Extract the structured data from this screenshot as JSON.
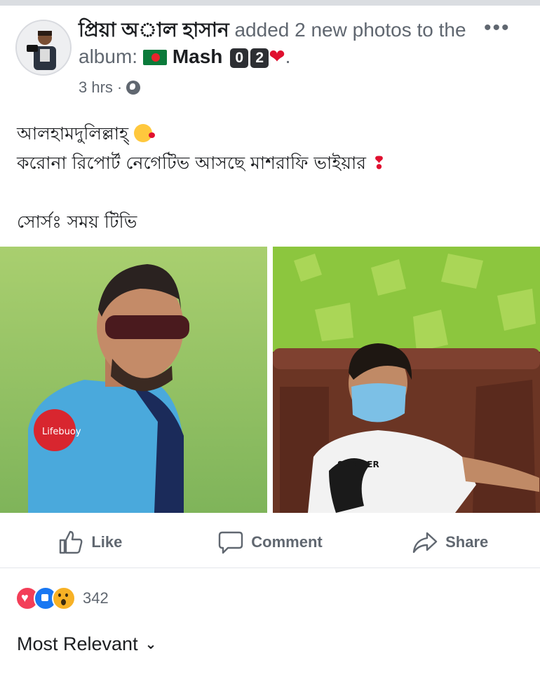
{
  "post": {
    "author": "প্রিয়া অাল হাসান",
    "action_text": "added 2 new photos to the album:",
    "album_name": "Mash",
    "album_digits": [
      "0",
      "2"
    ],
    "timestamp": "3 hrs",
    "privacy_icon": "globe-icon",
    "menu_icon": "more-icon",
    "text_lines": [
      "আলহামদুলিল্লাহ্",
      "করোনা রিপোর্ট নেগেটিভ আসছে মাশরাফি ভাইয়ার"
    ],
    "source_line": "সোর্সঃ সময় টিভি"
  },
  "photos": [
    {
      "name": "photo-cricketer-sunglasses",
      "shirt_text": "Lifebuoy"
    },
    {
      "name": "photo-man-mask-sofa",
      "shirt_text": "SUMMER"
    }
  ],
  "actions": {
    "like": "Like",
    "comment": "Comment",
    "share": "Share"
  },
  "reactions": {
    "types": [
      "love",
      "like",
      "wow"
    ],
    "count": "342"
  },
  "comments": {
    "sort_label": "Most Relevant"
  },
  "colors": {
    "like_blue": "#1877f2",
    "love_red": "#f33e58",
    "wow_yellow": "#f7b125",
    "secondary_text": "#606770"
  }
}
